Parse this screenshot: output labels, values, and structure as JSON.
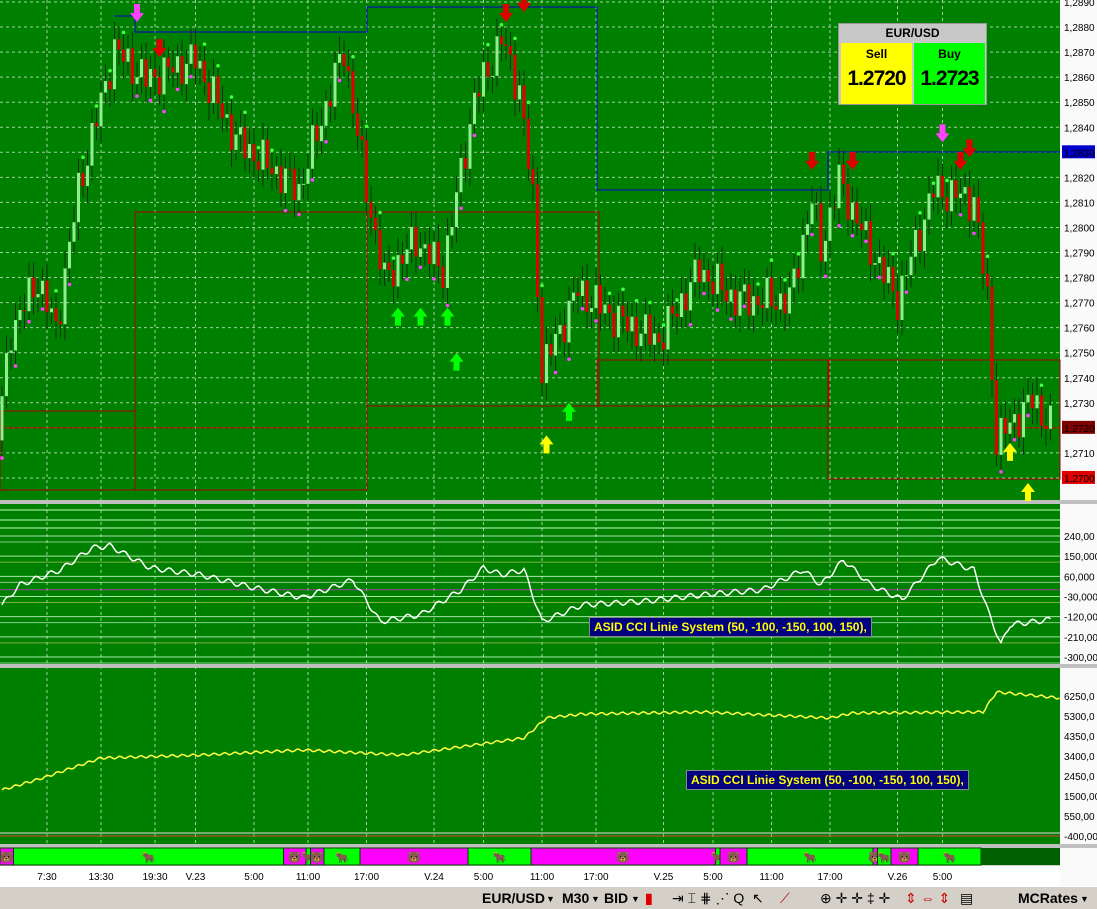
{
  "quote": {
    "symbol": "EUR/USD",
    "sell_label": "Sell",
    "buy_label": "Buy",
    "sell_price": "1.2720",
    "buy_price": "1.2723",
    "sell_color": "#ffff00",
    "buy_color": "#00ff00"
  },
  "colors": {
    "bg": "#008000",
    "bull": "#90ee90",
    "bear": "#e00000",
    "bull_bar": "#00ff00",
    "bear_bar": "#ff00ff"
  },
  "price_axis": {
    "labels": [
      "1,2890",
      "1,2880",
      "1,2870",
      "1,2860",
      "1,2850",
      "1,2840",
      "1,2830",
      "1,2820",
      "1,2810",
      "1,2800",
      "1,2790",
      "1,2780",
      "1,2770",
      "1,2760",
      "1,2750",
      "1,2740",
      "1,2730",
      "1,2720",
      "1,2710",
      "1,2700"
    ],
    "highlight": {
      "1,2830": "#0000cc",
      "1,2720": "#800000",
      "1,2700": "#e00000"
    }
  },
  "cci_axis": {
    "labels": [
      "240,00",
      "150,000",
      "60,000",
      "-30,000",
      "-120,00",
      "-210,00",
      "-300,00"
    ],
    "values": [
      240,
      150,
      60,
      -30,
      -120,
      -210,
      -300
    ]
  },
  "equity_axis": {
    "labels": [
      "6250,0",
      "5300,0",
      "4350,0",
      "3400,0",
      "2450,0",
      "1500,00",
      "550,00",
      "-400,00"
    ],
    "values": [
      6250,
      5300,
      4350,
      3400,
      2450,
      1500,
      550,
      -400
    ]
  },
  "indicator_label": "ASID CCI Linie System (50,  -100, -150,  100, 150),",
  "time_axis": [
    {
      "bar": 10,
      "label": "7:30"
    },
    {
      "bar": 22,
      "label": "13:30"
    },
    {
      "bar": 34,
      "label": "19:30"
    },
    {
      "bar": 43,
      "label": "V.23"
    },
    {
      "bar": 56,
      "label": "5:00"
    },
    {
      "bar": 68,
      "label": "11:00"
    },
    {
      "bar": 81,
      "label": "17:00"
    },
    {
      "bar": 96,
      "label": "V.24"
    },
    {
      "bar": 107,
      "label": "5:00"
    },
    {
      "bar": 120,
      "label": "11:00"
    },
    {
      "bar": 132,
      "label": "17:00"
    },
    {
      "bar": 147,
      "label": "V.25"
    },
    {
      "bar": 158,
      "label": "5:00"
    },
    {
      "bar": 171,
      "label": "11:00"
    },
    {
      "bar": 184,
      "label": "17:00"
    },
    {
      "bar": 199,
      "label": "V.26"
    },
    {
      "bar": 209,
      "label": "5:00"
    }
  ],
  "chart_data": {
    "type": "line",
    "title": "EUR/USD M30 BID",
    "price_keypoints": [
      [
        0,
        1.2715
      ],
      [
        3,
        1.2759
      ],
      [
        9,
        1.2779
      ],
      [
        13,
        1.2759
      ],
      [
        18,
        1.2815
      ],
      [
        22,
        1.2843
      ],
      [
        26,
        1.2871
      ],
      [
        33,
        1.2859
      ],
      [
        44,
        1.2867
      ],
      [
        53,
        1.2835
      ],
      [
        67,
        1.2815
      ],
      [
        77,
        1.2871
      ],
      [
        82,
        1.2815
      ],
      [
        86,
        1.2779
      ],
      [
        93,
        1.2795
      ],
      [
        99,
        1.2783
      ],
      [
        106,
        1.2851
      ],
      [
        112,
        1.2875
      ],
      [
        116,
        1.2855
      ],
      [
        119,
        1.2811
      ],
      [
        121,
        1.2743
      ],
      [
        129,
        1.2775
      ],
      [
        138,
        1.2763
      ],
      [
        147,
        1.2755
      ],
      [
        156,
        1.2783
      ],
      [
        164,
        1.2771
      ],
      [
        176,
        1.2771
      ],
      [
        181,
        1.2811
      ],
      [
        183,
        1.2791
      ],
      [
        187,
        1.2819
      ],
      [
        193,
        1.2795
      ],
      [
        200,
        1.2771
      ],
      [
        208,
        1.2815
      ],
      [
        217,
        1.2811
      ],
      [
        220,
        1.2771
      ],
      [
        222,
        1.2715
      ],
      [
        230,
        1.2731
      ],
      [
        234,
        1.2721
      ]
    ],
    "price_ylim": [
      1.27,
      1.289
    ],
    "cci_keypoints": [
      [
        0,
        -67
      ],
      [
        4,
        22
      ],
      [
        13,
        89
      ],
      [
        20,
        187
      ],
      [
        24,
        196
      ],
      [
        33,
        98
      ],
      [
        44,
        67
      ],
      [
        56,
        9
      ],
      [
        67,
        -36
      ],
      [
        78,
        44
      ],
      [
        84,
        -142
      ],
      [
        93,
        -111
      ],
      [
        102,
        0
      ],
      [
        107,
        98
      ],
      [
        111,
        67
      ],
      [
        116,
        89
      ],
      [
        120,
        -142
      ],
      [
        129,
        -67
      ],
      [
        142,
        -53
      ],
      [
        156,
        -22
      ],
      [
        169,
        0
      ],
      [
        178,
        89
      ],
      [
        182,
        22
      ],
      [
        187,
        133
      ],
      [
        193,
        22
      ],
      [
        200,
        -44
      ],
      [
        208,
        142
      ],
      [
        216,
        89
      ],
      [
        219,
        -89
      ],
      [
        222,
        -244
      ],
      [
        224,
        -156
      ],
      [
        233,
        -133
      ]
    ],
    "cci_ylim": [
      -300,
      240
    ],
    "equity_keypoints": [
      [
        0,
        1785
      ],
      [
        9,
        2355
      ],
      [
        22,
        3305
      ],
      [
        44,
        3447
      ],
      [
        67,
        3685
      ],
      [
        89,
        3447
      ],
      [
        100,
        3780
      ],
      [
        116,
        4255
      ],
      [
        121,
        5205
      ],
      [
        129,
        5395
      ],
      [
        156,
        5490
      ],
      [
        184,
        5205
      ],
      [
        189,
        5442
      ],
      [
        218,
        5490
      ],
      [
        221,
        6440
      ],
      [
        235,
        6155
      ]
    ],
    "equity_ylim": [
      -400,
      6250
    ],
    "signals": [
      {
        "bar": 30,
        "price": 1.2882,
        "type": "down-magenta"
      },
      {
        "bar": 35,
        "price": 1.2868,
        "type": "down-red"
      },
      {
        "bar": 88,
        "price": 1.2768,
        "type": "up-green"
      },
      {
        "bar": 93,
        "price": 1.2768,
        "type": "up-green"
      },
      {
        "bar": 99,
        "price": 1.2768,
        "type": "up-green"
      },
      {
        "bar": 101,
        "price": 1.275,
        "type": "up-green"
      },
      {
        "bar": 112,
        "price": 1.2882,
        "type": "down-red"
      },
      {
        "bar": 116,
        "price": 1.2886,
        "type": "down-red"
      },
      {
        "bar": 126,
        "price": 1.273,
        "type": "up-green"
      },
      {
        "bar": 121,
        "price": 1.2717,
        "type": "up-yellow"
      },
      {
        "bar": 180,
        "price": 1.2823,
        "type": "down-red"
      },
      {
        "bar": 189,
        "price": 1.2823,
        "type": "down-red"
      },
      {
        "bar": 209,
        "price": 1.2834,
        "type": "down-magenta"
      },
      {
        "bar": 213,
        "price": 1.2823,
        "type": "down-red"
      },
      {
        "bar": 215,
        "price": 1.2828,
        "type": "down-red"
      },
      {
        "bar": 224,
        "price": 1.2714,
        "type": "up-yellow"
      },
      {
        "bar": 228,
        "price": 1.2698,
        "type": "up-yellow"
      }
    ],
    "regime": [
      [
        "bear",
        0,
        3
      ],
      [
        "bull",
        3,
        63
      ],
      [
        "bear",
        63,
        68
      ],
      [
        "bull",
        68,
        69
      ],
      [
        "bear",
        69,
        72
      ],
      [
        "bull",
        72,
        80
      ],
      [
        "bear",
        80,
        104
      ],
      [
        "bull",
        104,
        118
      ],
      [
        "bear",
        118,
        159
      ],
      [
        "bull",
        159,
        160
      ],
      [
        "bear",
        160,
        166
      ],
      [
        "bull",
        166,
        194
      ],
      [
        "bear",
        194,
        195
      ],
      [
        "bull",
        195,
        198
      ],
      [
        "bear",
        198,
        204
      ],
      [
        "bull",
        204,
        218
      ]
    ]
  },
  "toolbar": {
    "symbol": "EUR/USD",
    "timeframe": "M30",
    "side": "BID",
    "provider": "MCRates"
  }
}
